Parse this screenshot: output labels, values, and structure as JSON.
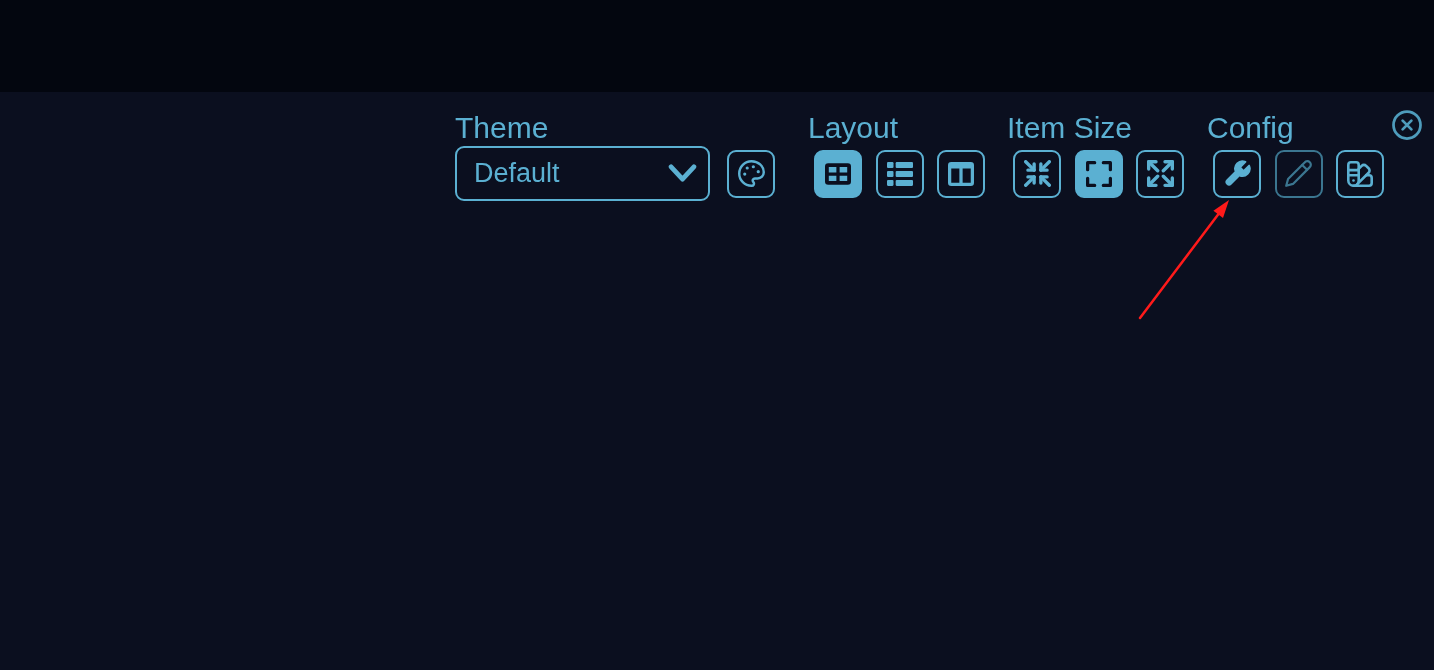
{
  "theme": {
    "label": "Theme",
    "value": "Default"
  },
  "sections": [
    {
      "label": "Layout",
      "buttons": [
        {
          "kind": "grid",
          "selected": true
        },
        {
          "kind": "list",
          "selected": false
        },
        {
          "kind": "columns",
          "selected": false
        }
      ]
    },
    {
      "label": "Item Size",
      "buttons": [
        {
          "kind": "compress",
          "selected": false
        },
        {
          "kind": "corners",
          "selected": true
        },
        {
          "kind": "expand",
          "selected": false
        }
      ]
    },
    {
      "label": "Config",
      "buttons": [
        {
          "kind": "wrench",
          "disabled": false
        },
        {
          "kind": "pencil",
          "disabled": true
        },
        {
          "kind": "swatchbook",
          "disabled": false
        }
      ]
    }
  ]
}
